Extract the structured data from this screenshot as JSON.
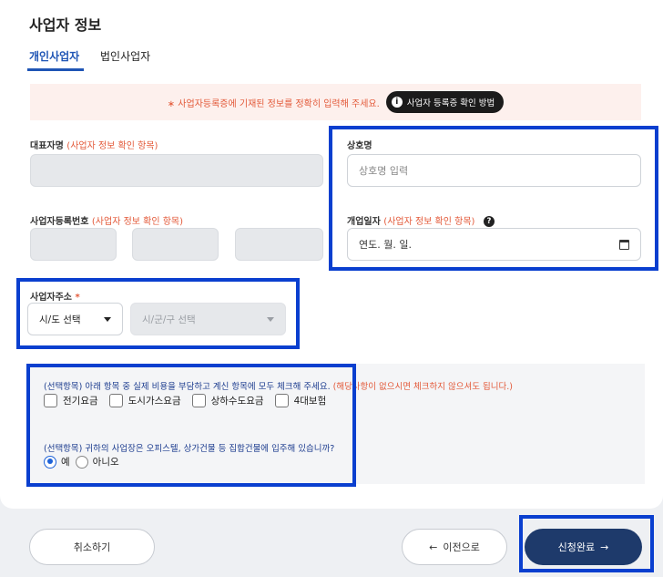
{
  "page_title": "사업자 정보",
  "tabs": [
    {
      "label": "개인사업자",
      "active": true
    },
    {
      "label": "법인사업자",
      "active": false
    }
  ],
  "notice": {
    "text": "∗ 사업자등록증에 기재된 정보를 정확히 입력해 주세요.",
    "button_label": "사업자 등록증 확인 방법"
  },
  "fields": {
    "representative": {
      "label": "대표자명",
      "sub": "(사업자 정보 확인 항목)"
    },
    "company_name": {
      "label": "상호명",
      "placeholder": "상호명 입력"
    },
    "business_number": {
      "label": "사업자등록번호",
      "sub": "(사업자 정보 확인 항목)"
    },
    "opening_date": {
      "label": "개업일자",
      "sub": "(사업자 정보 확인 항목)",
      "value": "연도. 월. 일."
    },
    "address": {
      "label": "사업자주소",
      "required_mark": "*",
      "province_select": "시/도 선택",
      "city_select": "시/군/구 선택"
    }
  },
  "optional": {
    "question1": "(선택항목) 아래 항목 중 실제 비용을 부담하고 계신 항목에 모두 체크해 주세요.",
    "question1_note": "(해당사항이 없으시면 체크하지 않으셔도 됩니다.)",
    "checkboxes": [
      "전기요금",
      "도시가스요금",
      "상하수도요금",
      "4대보험"
    ],
    "question2": "(선택항목) 귀하의 사업장은 오피스텔, 상가건물 등 집합건물에 입주해 있습니까?",
    "radios": [
      {
        "label": "예",
        "selected": true
      },
      {
        "label": "아니오",
        "selected": false
      }
    ]
  },
  "footer": {
    "cancel": "취소하기",
    "prev": "이전으로",
    "submit": "신청완료"
  },
  "colors": {
    "accent": "#1f55b5",
    "highlight_border": "#0a3fcf",
    "warning": "#e35a3a",
    "submit_bg": "#1e3a6b"
  },
  "icons": [
    "info-icon",
    "help-icon",
    "calendar-icon",
    "chevron-down-icon",
    "arrow-left-icon",
    "arrow-right-icon"
  ]
}
